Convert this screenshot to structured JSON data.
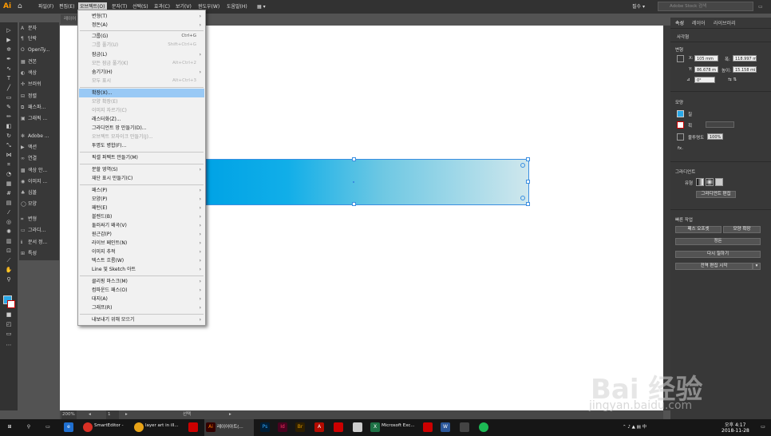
{
  "app": {
    "logo": "Ai",
    "workspace": "필수",
    "stock_search_placeholder": "Adobe Stock 검색"
  },
  "menubar": {
    "items": [
      "파일(F)",
      "편집(E)",
      "오브젝트(O)",
      "문자(T)",
      "선택(S)",
      "효과(C)",
      "보기(V)",
      "윈도우(W)",
      "도움말(H)"
    ]
  },
  "document": {
    "tab_label": "레이어",
    "zoom": "200%",
    "artboard_nav": "1",
    "status": "선택"
  },
  "left_panel": {
    "items": [
      "문자",
      "단락",
      "OpenTy...",
      "견본",
      "색상",
      "브러쉬",
      "정렬",
      "패스파...",
      "그래픽 ...",
      "Adobe ...",
      "액션",
      "연결",
      "색상 안...",
      "이미지 ...",
      "심볼",
      "모양",
      "변형",
      "그라디...",
      "문서 정...",
      "특성"
    ]
  },
  "object_menu": {
    "items": [
      {
        "label": "변형(T)",
        "shortcut": "",
        "submenu": true,
        "disabled": false
      },
      {
        "label": "정돈(A)",
        "shortcut": "",
        "submenu": true,
        "disabled": false
      },
      {
        "label": "그룹(G)",
        "shortcut": "Ctrl+G",
        "submenu": false,
        "disabled": false
      },
      {
        "label": "그룹 풀기(U)",
        "shortcut": "Shift+Ctrl+G",
        "submenu": false,
        "disabled": true
      },
      {
        "label": "잠금(L)",
        "shortcut": "",
        "submenu": true,
        "disabled": false
      },
      {
        "label": "모든 잠금 풀기(K)",
        "shortcut": "Alt+Ctrl+2",
        "submenu": false,
        "disabled": true
      },
      {
        "label": "숨기기(H)",
        "shortcut": "",
        "submenu": true,
        "disabled": false
      },
      {
        "label": "모두 표시",
        "shortcut": "Alt+Ctrl+3",
        "submenu": false,
        "disabled": true
      },
      {
        "label": "확장(X)...",
        "shortcut": "",
        "submenu": false,
        "disabled": false,
        "highlighted": true
      },
      {
        "label": "모양 확장(E)",
        "shortcut": "",
        "submenu": false,
        "disabled": true
      },
      {
        "label": "이미지 자르기(C)",
        "shortcut": "",
        "submenu": false,
        "disabled": true
      },
      {
        "label": "래스터화(Z)...",
        "shortcut": "",
        "submenu": false,
        "disabled": false
      },
      {
        "label": "그라디언트 망 만들기(D)...",
        "shortcut": "",
        "submenu": false,
        "disabled": false
      },
      {
        "label": "오브젝트 모자이크 만들기(J)...",
        "shortcut": "",
        "submenu": false,
        "disabled": true
      },
      {
        "label": "투명도 병합(F)...",
        "shortcut": "",
        "submenu": false,
        "disabled": false
      },
      {
        "label": "픽셀 퍼펙트 만들기(M)",
        "shortcut": "",
        "submenu": false,
        "disabled": false
      },
      {
        "label": "분할 영역(S)",
        "shortcut": "",
        "submenu": true,
        "disabled": false
      },
      {
        "label": "재단 표시 만들기(C)",
        "shortcut": "",
        "submenu": false,
        "disabled": false
      },
      {
        "label": "패스(P)",
        "shortcut": "",
        "submenu": true,
        "disabled": false
      },
      {
        "label": "모양(P)",
        "shortcut": "",
        "submenu": true,
        "disabled": false
      },
      {
        "label": "패턴(E)",
        "shortcut": "",
        "submenu": true,
        "disabled": false
      },
      {
        "label": "블렌드(B)",
        "shortcut": "",
        "submenu": true,
        "disabled": false
      },
      {
        "label": "둘러싸기 왜곡(V)",
        "shortcut": "",
        "submenu": true,
        "disabled": false
      },
      {
        "label": "원근감(P)",
        "shortcut": "",
        "submenu": true,
        "disabled": false
      },
      {
        "label": "라이브 페인트(N)",
        "shortcut": "",
        "submenu": true,
        "disabled": false
      },
      {
        "label": "이미지 추적",
        "shortcut": "",
        "submenu": true,
        "disabled": false
      },
      {
        "label": "텍스트 흐름(W)",
        "shortcut": "",
        "submenu": true,
        "disabled": false
      },
      {
        "label": "Line 및 Sketch 아트",
        "shortcut": "",
        "submenu": true,
        "disabled": false
      },
      {
        "label": "클리핑 마스크(M)",
        "shortcut": "",
        "submenu": true,
        "disabled": false
      },
      {
        "label": "컴파운드 패스(O)",
        "shortcut": "",
        "submenu": true,
        "disabled": false
      },
      {
        "label": "대지(A)",
        "shortcut": "",
        "submenu": true,
        "disabled": false
      },
      {
        "label": "그래프(R)",
        "shortcut": "",
        "submenu": true,
        "disabled": false
      },
      {
        "label": "내보내기 위해 모으기",
        "shortcut": "",
        "submenu": true,
        "disabled": false
      }
    ]
  },
  "right_panel": {
    "tabs": [
      "속성",
      "레이어",
      "라이브러리"
    ],
    "selection_type": "사각형",
    "transform_title": "변형",
    "x_label": "X:",
    "x_value": "105 mm",
    "w_label": "폭:",
    "w_value": "118.997 m",
    "y_label": "Y:",
    "y_value": "86.678 m",
    "h_label": "높이:",
    "h_value": "15.158 mi",
    "angle_value": "0°",
    "appearance_title": "모양",
    "fill_label": "칠",
    "stroke_label": "획",
    "opacity_label": "불투명도",
    "opacity_value": "100%",
    "fx_label": "fx.",
    "gradient_title": "그라디언트",
    "gradient_type_label": "유형",
    "gradient_edit_button": "그라디언트 편집",
    "quick_actions_title": "빠른 작업",
    "offset_path_button": "패스 오프셋",
    "expand_shape_button": "모양 확장",
    "arrange_button": "정돈",
    "recolor_button": "다시 칠하기",
    "start_global_edit_button": "전역 편집 시작"
  },
  "taskbar": {
    "apps": [
      {
        "label": "SmartEditor -",
        "color": "#d93025",
        "icon": "●"
      },
      {
        "label": "layer art in ill...",
        "color": "#e8a317",
        "icon": "●"
      },
      {
        "label": "레이어아트(...",
        "color": "#ff7c00",
        "icon": "Ai"
      },
      {
        "label": "Microsoft Exc...",
        "color": "#1e7145",
        "icon": "X"
      }
    ],
    "time": "오후 4:17",
    "date": "2018-11-28"
  },
  "watermark": {
    "brand": "Bai 经验",
    "url": "jingyan.baidu.com"
  },
  "colors": {
    "gradient_start": "#00a3e6",
    "gradient_end": "#cfe7ed",
    "menu_highlight": "#99c9f5",
    "accent_orange": "#ff9a00"
  }
}
